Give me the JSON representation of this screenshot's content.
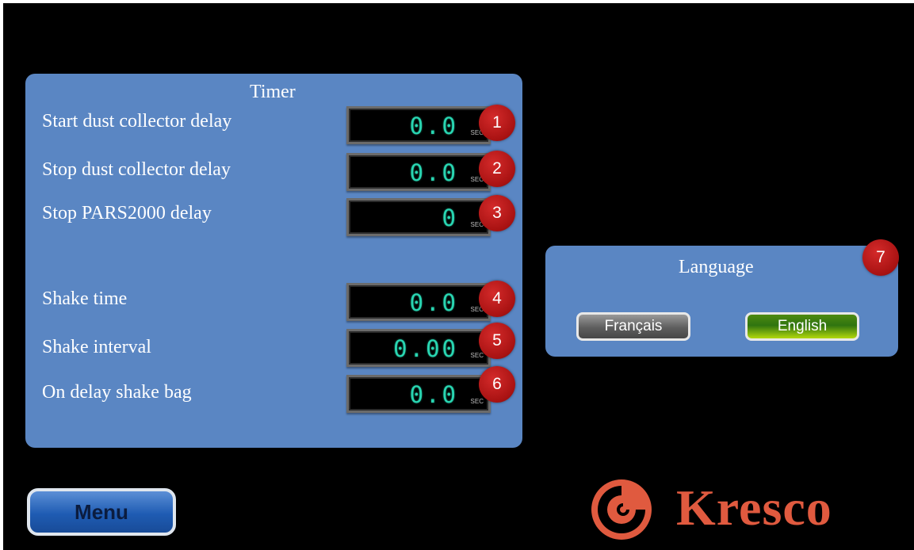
{
  "timer": {
    "title": "Timer",
    "rows": [
      {
        "label": "Start dust collector delay",
        "value": "0.0",
        "unit": "SEC",
        "badge": "1"
      },
      {
        "label": "Stop dust collector delay",
        "value": "0.0",
        "unit": "SEC",
        "badge": "2"
      },
      {
        "label": "Stop PARS2000 delay",
        "value": "0",
        "unit": "SEC",
        "badge": "3"
      },
      {
        "label": "Shake time",
        "value": "0.0",
        "unit": "SEC",
        "badge": "4"
      },
      {
        "label": "Shake interval",
        "value": "0.00",
        "unit": "SEC",
        "badge": "5"
      },
      {
        "label": "On delay shake bag",
        "value": "0.0",
        "unit": "SEC",
        "badge": "6"
      }
    ]
  },
  "language": {
    "title": "Language",
    "badge": "7",
    "buttons": {
      "french": "Français",
      "english": "English"
    }
  },
  "menu": {
    "label": "Menu"
  },
  "logo": {
    "text": "Kresco",
    "color": "#e05a3f"
  },
  "colors": {
    "panel": "#5a86c3",
    "display_digits": "#29d6b2",
    "badge": "#b51a1a",
    "background": "#000000"
  },
  "icons": {
    "logo_mark": "kresco-swirl-icon"
  }
}
